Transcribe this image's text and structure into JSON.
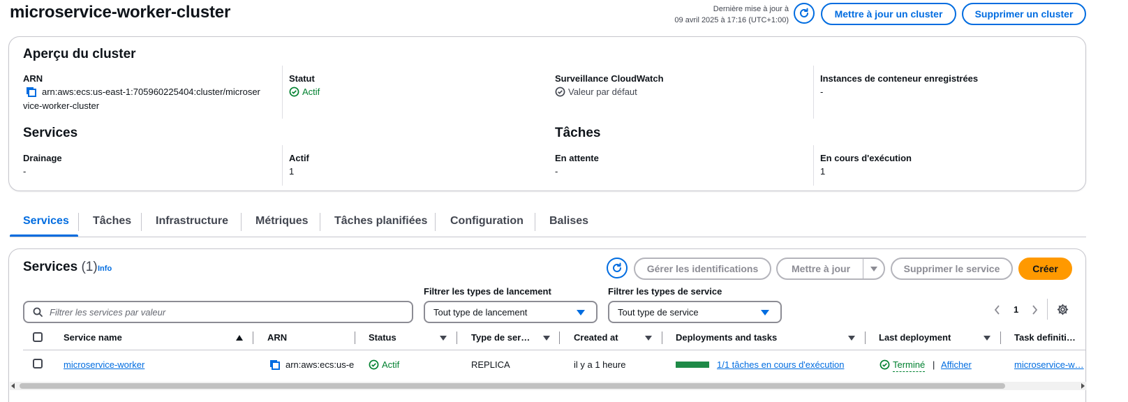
{
  "page": {
    "title": "microservice-worker-cluster",
    "last_update_label": "Dernière mise à jour à",
    "last_update_time": "09 avril 2025 à 17:16 (UTC+1:00)",
    "update_cluster_label": "Mettre à jour un cluster",
    "delete_cluster_label": "Supprimer un cluster"
  },
  "overview": {
    "title": "Aperçu du cluster",
    "arn_label": "ARN",
    "arn_line1": "arn:aws:ecs:us-east-1:705960225404:cluster/microser",
    "arn_line2": "vice-worker-cluster",
    "status_label": "Statut",
    "status_value": "Actif",
    "cloudwatch_label": "Surveillance CloudWatch",
    "cloudwatch_value": "Valeur par défaut",
    "instances_label": "Instances de conteneur enregistrées",
    "instances_value": "-",
    "services_title": "Services",
    "draining_label": "Drainage",
    "draining_value": "-",
    "active_label": "Actif",
    "active_value": "1",
    "tasks_title": "Tâches",
    "pending_label": "En attente",
    "pending_value": "-",
    "running_label": "En cours d'exécution",
    "running_value": "1"
  },
  "tabs": [
    "Services",
    "Tâches",
    "Infrastructure",
    "Métriques",
    "Tâches planifiées",
    "Configuration",
    "Balises"
  ],
  "services_panel": {
    "title": "Services",
    "count": "(1)",
    "info": "Info",
    "manage_ids": "Gérer les identifications",
    "update": "Mettre à jour",
    "delete": "Supprimer le service",
    "create": "Créer",
    "search_placeholder": "Filtrer les services par valeur",
    "launch_filter_label": "Filtrer les types de lancement",
    "launch_filter_value": "Tout type de lancement",
    "service_filter_label": "Filtrer les types de service",
    "service_filter_value": "Tout type de service",
    "page_number": "1"
  },
  "table": {
    "headers": [
      "Service name",
      "ARN",
      "Status",
      "Type de ser…",
      "Created at",
      "Deployments and tasks",
      "Last deployment",
      "Task definiti…"
    ],
    "rows": [
      {
        "service_name": "microservice-worker",
        "arn": "arn:aws:ecs:us-e",
        "status": "Actif",
        "type": "REPLICA",
        "created_at": "il y a 1 heure",
        "tasks_progress": 1.0,
        "deployments": "1/1 tâches en cours d'exécution",
        "last_deployment_status": "Terminé",
        "last_deployment_separator": "|",
        "last_deployment_link": "Afficher",
        "task_definition": "microservice-w…"
      }
    ]
  },
  "colors": {
    "accent": "#006ce0",
    "success": "#00802f",
    "primary_button": "#ff9900",
    "progress": "#1f8a47"
  }
}
